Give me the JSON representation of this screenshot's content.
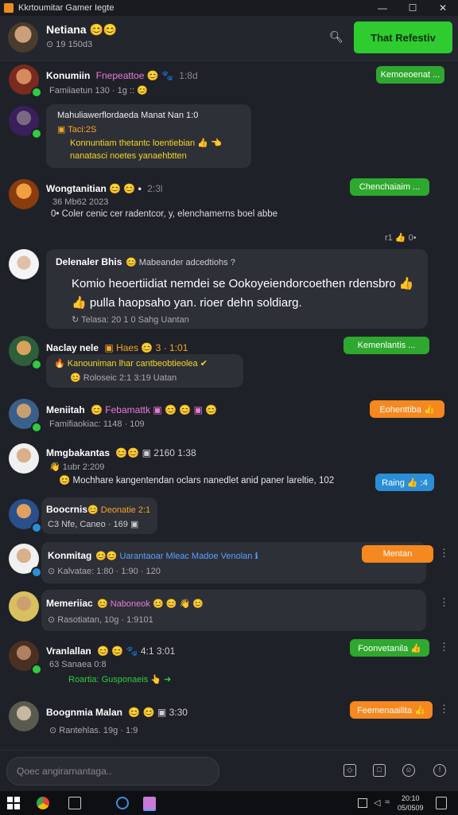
{
  "window": {
    "title": "Kkrtoumitar Gamer Iegte",
    "controls": [
      "—",
      "☐",
      "✕"
    ]
  },
  "header": {
    "name": "Netiana 😊😊",
    "status": "⊙ 19 150d3",
    "search_icon": "search-icon",
    "cta": "That Refestiv"
  },
  "messages": [
    {
      "name": "Konumiin",
      "tag": "Fnepeattoe 😊 🐾",
      "tag_color": "#e87ad8",
      "time": "1:8d",
      "sub": "Famiiaetun  130 · 1g :: 😊",
      "pill": "Kemoeoenat ...",
      "pill_color": "green"
    },
    {
      "name": "Mahuliawerflordaeda  Manat  Nan 1:0",
      "line2": "▣ Taci:2S",
      "line3": "Konnuntiam thetantc loentiebian 👍 👈",
      "line4": "nanatasci  noetes  yanaehbtten"
    },
    {
      "name": "Wongtanitian 😊 😊 •",
      "time": "2:3l",
      "sub": "36  Mb62 2023",
      "body": "0•  Coler cenic cer radentcor, y, elenchamerns boel abbe",
      "pill": "Chenchaiaim ...",
      "pill_color": "green",
      "reactions": "r1  👍  0•"
    },
    {
      "name": "Delenaler Bhis",
      "tag": "😊  Mabeander adcedtiohs  ?",
      "tag_color": "#cfcfcf",
      "body1": "Komio heoertiidiat  nemdei se  Ookoyeiendorcoethen rdensbro 👍",
      "body2": "👍  pulla haopsaho yan. rioer dehn soldiarg.",
      "footer": "↻  Telasa:  20 1 0 Sahg  Uantan"
    },
    {
      "name": "Naclay nele",
      "tag": "▣  Haes 😊  3 · 1:01",
      "tag_color": "#f5a623",
      "line2": "🔥  Kanouniman  lhar  cantbeobtieolea ✔",
      "line3": "😊  Roloseic  2:1  3:19  Uatan",
      "pill": "Kemenlantis ...",
      "pill_color": "green"
    },
    {
      "name": "Meniitah",
      "tag": "😊 Febamattk ▣ 😊 😊 ▣ 😊",
      "tag_color": "#e87ad8",
      "sub": "Famifiaokiac:  1148  ·  109",
      "pill": "Eohenttiba 👍",
      "pill_color": "orange"
    },
    {
      "name": "Mmgbakantas",
      "tag": "😊😊 ▣  2160  1:38",
      "tag_color": "#cfcfcf",
      "sub": "👋  1ubr 2:209",
      "body": "😊  Mochhare kangentendan oclars nanedlet anid paner lareltie,  102",
      "pill": "Raing 👍 :4",
      "pill_color": "blue"
    },
    {
      "name": "Boocrnis",
      "tag": "😊 Deonatie 2:1",
      "tag_color": "#f5a623",
      "sub": "C3  Nfe,  Caneo  ·  169  ▣"
    },
    {
      "name": "Konmitag",
      "tag": "😊😊  Uarantaoar Mleac  Madoe  Venolan  ℹ",
      "tag_color": "#5aa0ff",
      "sub": "⊙  Kalvatae:  1:80 · 1:90 · 120",
      "pill": "Mentan",
      "pill_color": "orange"
    },
    {
      "name": "Memeriiac",
      "tag": "😊 Naboneok 😊 😊 👋 😊",
      "tag_color": "#e87ad8",
      "sub": "⊙  Rasotiatan,  10g  ·  1:9101"
    },
    {
      "name": "Vranlallan",
      "tag": "😊 😊  🐾  4:1  3:01",
      "tag_color": "#cfcfcf",
      "sub": "63  Sanaea 0:8",
      "line3": "Roartia:  Gusponaeis  👆  ➜",
      "pill": "Foonvetanila 👍",
      "pill_color": "green"
    },
    {
      "name": "Boognmia Malan",
      "tag": "😊 😊  ▣  3:30",
      "tag_color": "#cfcfcf",
      "sub": "⊙  Rantehlas.  19g  ·  1:9",
      "pill": "Feemenaailita 👍",
      "pill_color": "orange"
    }
  ],
  "composer": {
    "placeholder": "Qoec angirarnantaga.."
  },
  "taskbar": {
    "time": "20:10",
    "date": "05/0509"
  }
}
